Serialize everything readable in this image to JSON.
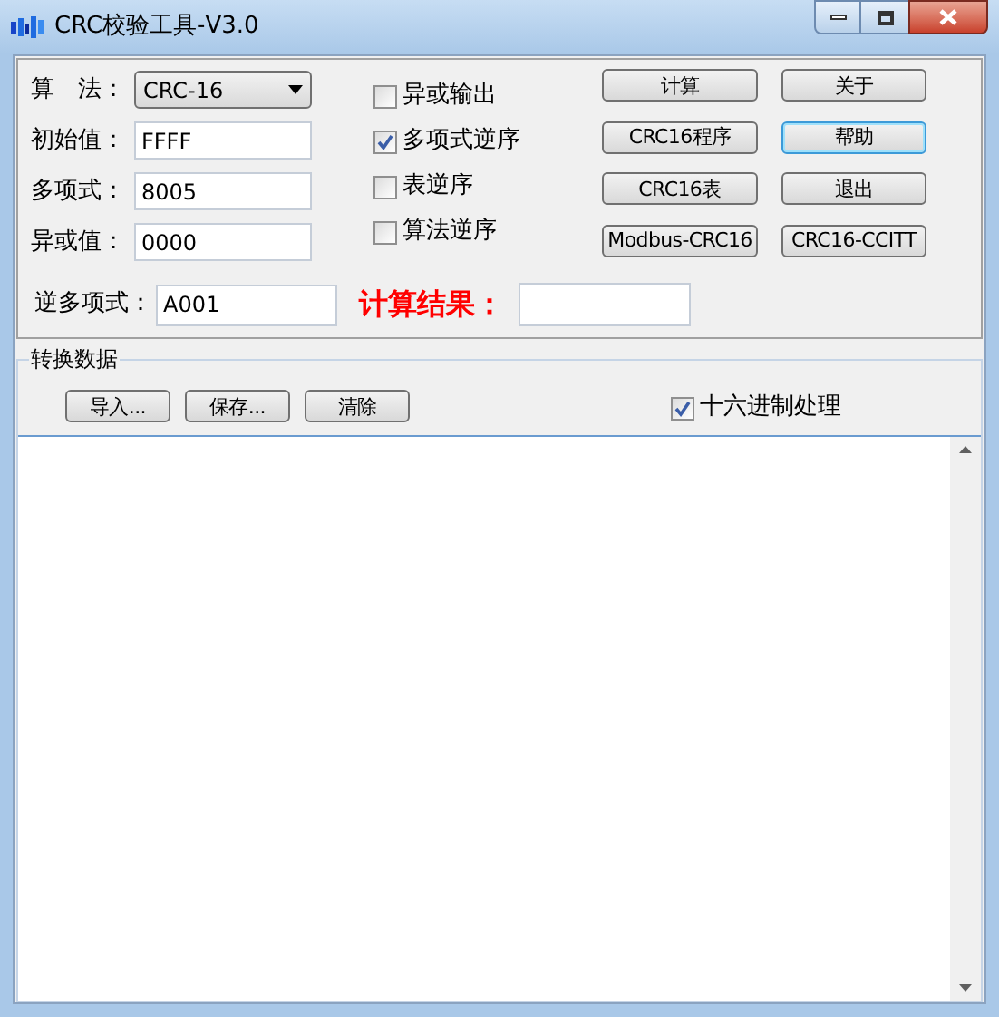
{
  "window": {
    "title": "CRC校验工具-V3.0"
  },
  "params": [
    {
      "label": "算　法：",
      "kind": "select",
      "value": "CRC-16"
    },
    {
      "label": "初始值：",
      "kind": "input",
      "value": "FFFF"
    },
    {
      "label": "多项式：",
      "kind": "input",
      "value": "8005"
    },
    {
      "label": "异或值：",
      "kind": "input",
      "value": "0000"
    }
  ],
  "options": [
    {
      "label": "异或输出",
      "checked": false
    },
    {
      "label": "多项式逆序",
      "checked": true
    },
    {
      "label": "表逆序",
      "checked": false
    },
    {
      "label": "算法逆序",
      "checked": false
    }
  ],
  "buttons": [
    {
      "label": "计算",
      "focused": false
    },
    {
      "label": "关于",
      "focused": false
    },
    {
      "label": "CRC16程序",
      "focused": false
    },
    {
      "label": "帮助",
      "focused": true
    },
    {
      "label": "CRC16表",
      "focused": false
    },
    {
      "label": "退出",
      "focused": false
    },
    {
      "label": "Modbus-CRC16",
      "focused": false
    },
    {
      "label": "CRC16-CCITT",
      "focused": false
    }
  ],
  "reverse_poly": {
    "label": "逆多项式：",
    "value": "A001"
  },
  "result": {
    "label": "计算结果："
  },
  "data_section": {
    "title": "转换数据",
    "buttons": [
      {
        "label": "导入..."
      },
      {
        "label": "保存..."
      },
      {
        "label": "清除"
      }
    ],
    "hex_option": {
      "label": "十六进制处理",
      "checked": true
    }
  }
}
